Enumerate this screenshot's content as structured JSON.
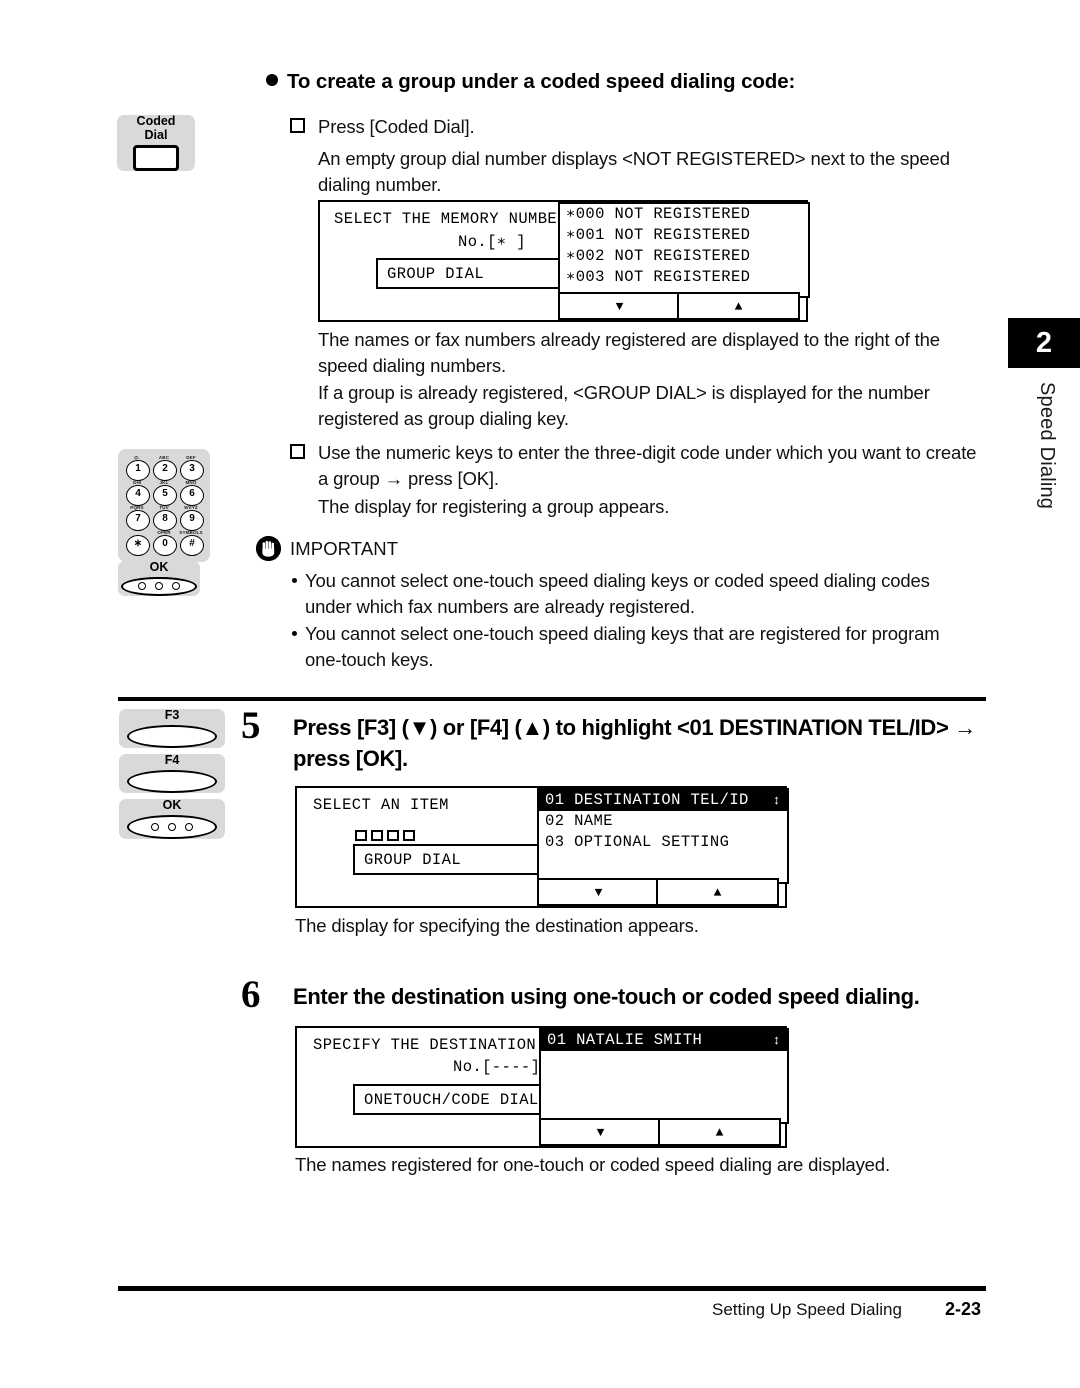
{
  "page": {
    "section_number": "2",
    "section_name": "Speed Dialing",
    "footer_title": "Setting Up Speed Dialing",
    "footer_page": "2-23"
  },
  "heading": {
    "text": "To create a group under a coded speed dialing code:"
  },
  "procedure": {
    "item1": "Press [Coded Dial].",
    "item1_note": "An empty group dial number displays <NOT REGISTERED> next to the speed dialing number.",
    "note_after_screen1_a": "The names or fax numbers already registered are displayed to the right of the speed dialing numbers.",
    "note_after_screen1_b": "If a group is already registered, <GROUP DIAL> is displayed for the number registered as group dialing key.",
    "item2": "Use the numeric keys to enter the three-digit code under which you want to create a group → press [OK].",
    "item2_note": "The display for registering a group appears."
  },
  "important": {
    "label": "IMPORTANT",
    "icon": "hand-icon",
    "bullets": [
      "You cannot select one-touch speed dialing keys or coded speed dialing codes under which fax numbers are already registered.",
      "You cannot select one-touch speed dialing keys that are registered for program one-touch keys."
    ]
  },
  "steps": [
    {
      "number": "5",
      "text": "Press [F3] (▼) or [F4] (▲) to highlight <01 DESTINATION TEL/ID> → press [OK].",
      "note": "The display for specifying the destination appears."
    },
    {
      "number": "6",
      "text": "Enter the destination using one-touch or coded speed dialing.",
      "note": "The names registered for one-touch or coded speed dialing are displayed."
    }
  ],
  "panel_keys": {
    "coded_dial": {
      "line1": "Coded",
      "line2": "Dial",
      "icon": "rectangular-key-icon"
    },
    "f3": "F3",
    "f4": "F4",
    "ok": "OK",
    "keypad": {
      "keys": [
        {
          "sub": "@.",
          "main": "1"
        },
        {
          "sub": "ABC",
          "main": "2"
        },
        {
          "sub": "DEF",
          "main": "3"
        },
        {
          "sub": "GHI",
          "main": "4"
        },
        {
          "sub": "JKL",
          "main": "5"
        },
        {
          "sub": "MNO",
          "main": "6"
        },
        {
          "sub": "PQRS",
          "main": "7"
        },
        {
          "sub": "TUV",
          "main": "8"
        },
        {
          "sub": "WXYZ",
          "main": "9"
        },
        {
          "sub": "",
          "main": "∗"
        },
        {
          "sub": "OPER",
          "main": "0"
        },
        {
          "sub": "SYMBOLS",
          "main": "#"
        }
      ]
    }
  },
  "screens": {
    "screen1": {
      "title": "SELECT THE MEMORY NUMBER",
      "subtitle": "No.[∗   ]",
      "tag": "GROUP DIAL",
      "list": [
        "∗000 NOT REGISTERED",
        "∗001 NOT REGISTERED",
        "∗002 NOT REGISTERED",
        "∗003 NOT REGISTERED"
      ],
      "btn_down": "▼",
      "btn_up": "▲"
    },
    "screen2": {
      "title": "SELECT AN ITEM",
      "tag": "GROUP DIAL",
      "list": [
        "01 DESTINATION TEL/ID",
        "02 NAME",
        "03 OPTIONAL SETTING"
      ],
      "selected_index": 0,
      "scroll_glyph": "↕",
      "btn_down": "▼",
      "btn_up": "▲"
    },
    "screen3": {
      "title": "SPECIFY THE DESTINATION",
      "subtitle": "No.[----]",
      "tag": "ONETOUCH/CODE DIAL",
      "list": [
        "01   NATALIE SMITH"
      ],
      "selected_index": 0,
      "scroll_glyph": "↕",
      "btn_down": "▼",
      "btn_up": "▲"
    }
  }
}
